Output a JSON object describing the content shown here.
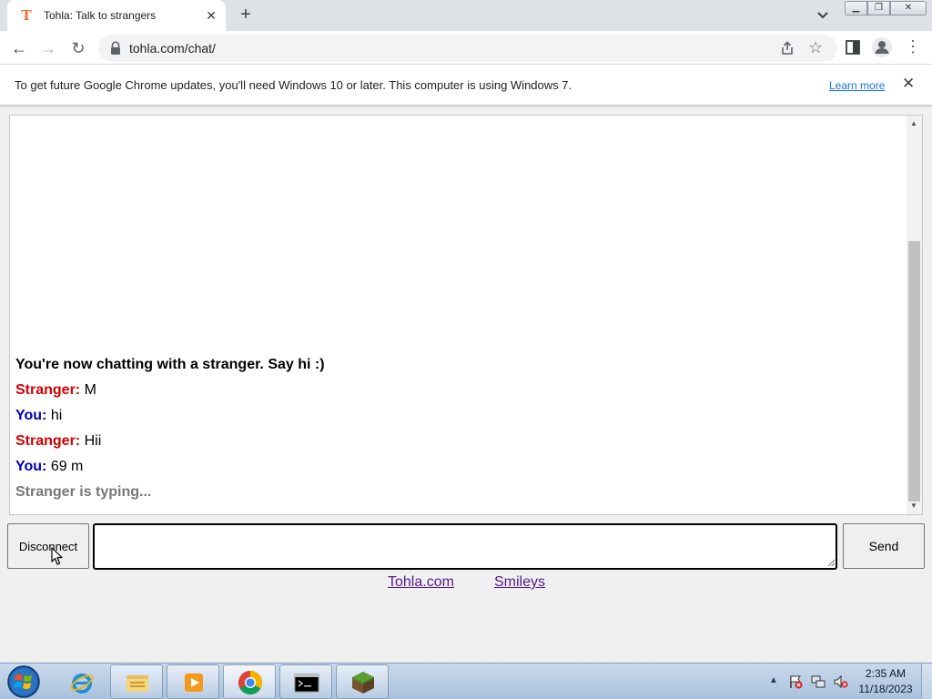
{
  "browser": {
    "tab_title": "Tohla: Talk to strangers",
    "favicon_letter": "T",
    "url": "tohla.com/chat/"
  },
  "infobar": {
    "message": "To get future Google Chrome updates, you'll need Windows 10 or later. This computer is using Windows 7.",
    "learn_more": "Learn more"
  },
  "chat": {
    "status": "You're now chatting with a stranger. Say hi :)",
    "messages": [
      {
        "sender": "Stranger:",
        "text": "M",
        "role": "stranger"
      },
      {
        "sender": "You:",
        "text": "hi",
        "role": "you"
      },
      {
        "sender": "Stranger:",
        "text": "Hii",
        "role": "stranger"
      },
      {
        "sender": "You:",
        "text": "69 m",
        "role": "you"
      }
    ],
    "typing": "Stranger is typing..."
  },
  "controls": {
    "disconnect_label": "Disconnect",
    "input_value": "",
    "send_label": "Send"
  },
  "footer": {
    "links": [
      "Tohla.com",
      "Smileys"
    ]
  },
  "taskbar": {
    "time": "2:35 AM",
    "date": "11/18/2023"
  },
  "colors": {
    "stranger": "#d20000",
    "you": "#0000b3",
    "typing": "#777777"
  }
}
